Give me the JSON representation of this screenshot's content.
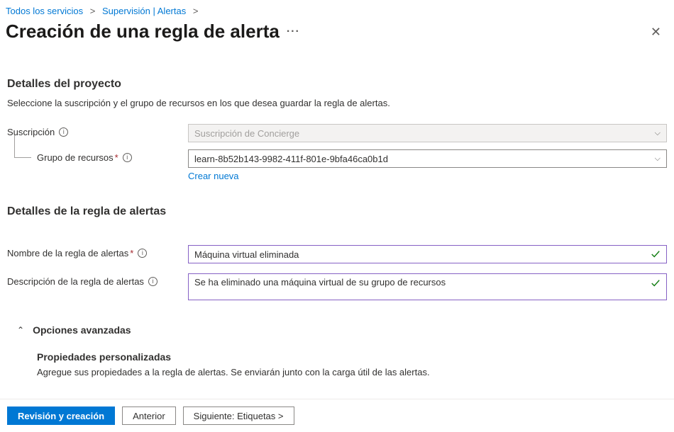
{
  "breadcrumb": {
    "item1": "Todos los servicios",
    "item2": "Supervisión | Alertas"
  },
  "header": {
    "title": "Creación de una regla de alerta"
  },
  "project": {
    "heading": "Detalles del proyecto",
    "desc": "Seleccione la suscripción y el grupo de recursos en los que desea guardar la regla de alertas.",
    "subscription_label": "Suscripción",
    "subscription_value": "Suscripción de Concierge",
    "rg_label": "Grupo de recursos",
    "rg_value": "learn-8b52b143-9982-411f-801e-9bfa46ca0b1d",
    "create_new": "Crear nueva"
  },
  "rule": {
    "heading": "Detalles de la regla de alertas",
    "name_label": "Nombre de la regla de alertas",
    "name_value": "Máquina virtual eliminada",
    "desc_label": "Descripción de la regla de alertas",
    "desc_value": "Se ha eliminado una máquina virtual de su grupo de recursos"
  },
  "advanced": {
    "toggle": "Opciones avanzadas",
    "custom_heading": "Propiedades personalizadas",
    "custom_desc": "Agregue sus propiedades a la regla de alertas. Se enviarán junto con la carga útil de las alertas."
  },
  "footer": {
    "review": "Revisión y creación",
    "previous": "Anterior",
    "next": "Siguiente: Etiquetas  >"
  }
}
